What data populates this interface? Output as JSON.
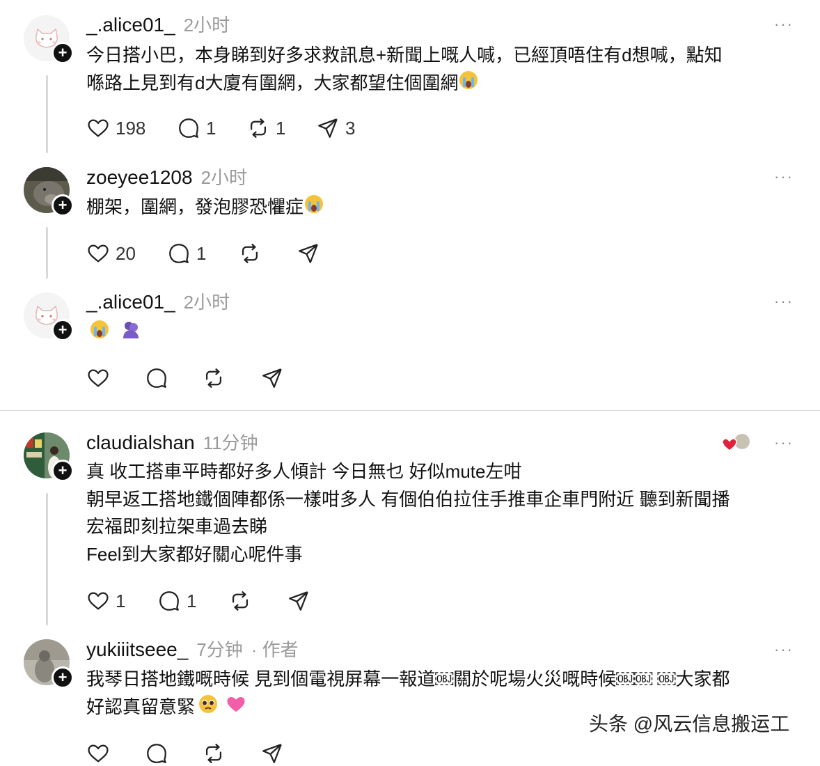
{
  "posts": [
    {
      "username": "_.alice01_",
      "time": "2小时",
      "lines": [
        "今日搭小巴，本身睇到好多求救訊息+新聞上嘅人喊，已經頂唔住有d想喊，點知",
        "喺路上見到有d大廈有圍網，大家都望住個圍網"
      ],
      "likes": "198",
      "replies": "1",
      "reposts": "1",
      "shares": "3"
    },
    {
      "username": "zoeyee1208",
      "time": "2小时",
      "lines": [
        "棚架，圍網，發泡膠恐懼症"
      ],
      "likes": "20",
      "replies": "1"
    },
    {
      "username": "_.alice01_",
      "time": "2小时"
    },
    {
      "username": "claudialshan",
      "time": "11分钟",
      "lines": [
        "真 收工搭車平時都好多人傾計 今日無乜 好似mute左咁",
        "朝早返工搭地鐵個陣都係一樣咁多人 有個伯伯拉住手推車企車門附近 聽到新聞播",
        "宏福即刻拉架車過去睇",
        "Feel到大家都好關心呢件事"
      ],
      "likes": "1",
      "replies": "1"
    },
    {
      "username": "yukiiitseee_",
      "time": "7分钟",
      "author_tag": "· 作者",
      "lines": [
        "我琴日搭地鐵嘅時候 見到個電視屏幕一報道￼關於呢場火災嘅時候￼￼ ￼大家都",
        "好認真留意緊"
      ]
    }
  ],
  "more_label": "···",
  "icons": [
    "heart-icon",
    "comment-icon",
    "repost-icon",
    "share-icon",
    "plus-icon",
    "crying-emoji",
    "hug-emoji",
    "pleading-emoji",
    "pink-heart-emoji"
  ],
  "watermark": "头条 @风云信息搬运工"
}
